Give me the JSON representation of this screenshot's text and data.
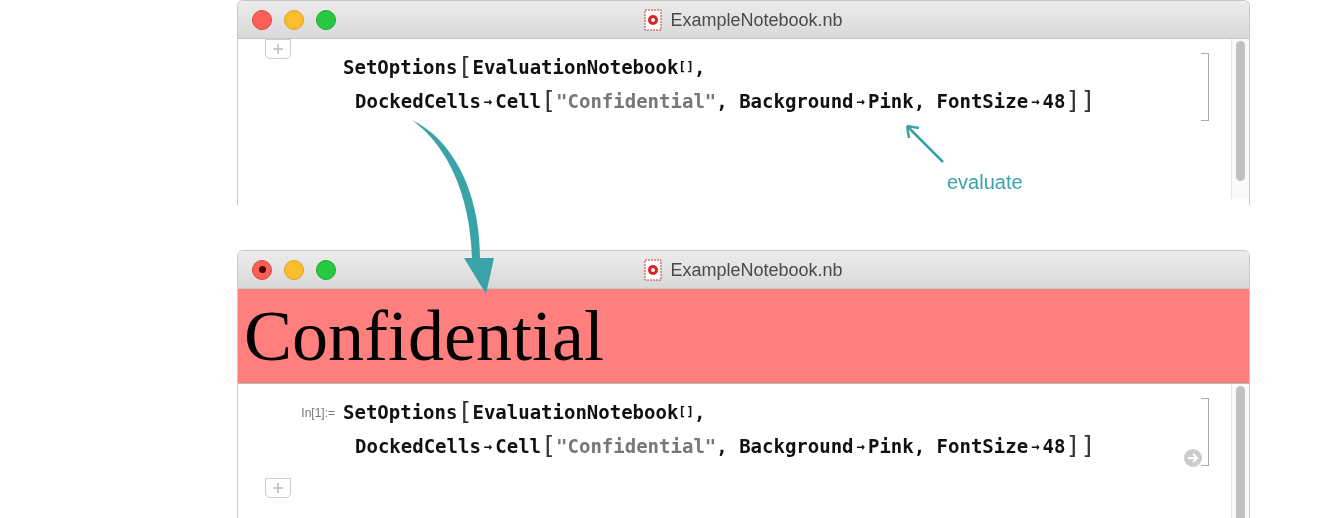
{
  "windows": [
    {
      "title": "ExampleNotebook.nb",
      "edited": false,
      "cell": {
        "lines": [
          [
            {
              "kind": "name",
              "text": "SetOptions"
            },
            {
              "kind": "bracket",
              "text": "["
            },
            {
              "kind": "name",
              "text": "EvaluationNotebook"
            },
            {
              "kind": "small",
              "text": "[]"
            },
            {
              "kind": "name",
              "text": ","
            }
          ],
          [
            {
              "kind": "name",
              "text": "DockedCells"
            },
            {
              "kind": "arrow",
              "text": "→"
            },
            {
              "kind": "name",
              "text": "Cell"
            },
            {
              "kind": "bracket",
              "text": "["
            },
            {
              "kind": "string",
              "text": "\"Confidential\""
            },
            {
              "kind": "name",
              "text": ", Background"
            },
            {
              "kind": "arrow",
              "text": "→"
            },
            {
              "kind": "name",
              "text": "Pink, FontSize"
            },
            {
              "kind": "arrow",
              "text": "→"
            },
            {
              "kind": "name",
              "text": "48"
            },
            {
              "kind": "bracket",
              "text": "]]"
            }
          ]
        ]
      }
    },
    {
      "title": "ExampleNotebook.nb",
      "edited": true,
      "docked_cell": {
        "text": "Confidential",
        "color": "#ff7f7f"
      },
      "cell": {
        "label": "In[1]:=",
        "lines": [
          [
            {
              "kind": "name",
              "text": "SetOptions"
            },
            {
              "kind": "bracket",
              "text": "["
            },
            {
              "kind": "name",
              "text": "EvaluationNotebook"
            },
            {
              "kind": "small",
              "text": "[]"
            },
            {
              "kind": "name",
              "text": ","
            }
          ],
          [
            {
              "kind": "name",
              "text": "DockedCells"
            },
            {
              "kind": "arrow",
              "text": "→"
            },
            {
              "kind": "name",
              "text": "Cell"
            },
            {
              "kind": "bracket",
              "text": "["
            },
            {
              "kind": "string",
              "text": "\"Confidential\""
            },
            {
              "kind": "name",
              "text": ", Background"
            },
            {
              "kind": "arrow",
              "text": "→"
            },
            {
              "kind": "name",
              "text": "Pink, FontSize"
            },
            {
              "kind": "arrow",
              "text": "→"
            },
            {
              "kind": "name",
              "text": "48"
            },
            {
              "kind": "bracket",
              "text": "]]"
            }
          ]
        ]
      }
    }
  ],
  "annotation": {
    "text": "evaluate"
  }
}
